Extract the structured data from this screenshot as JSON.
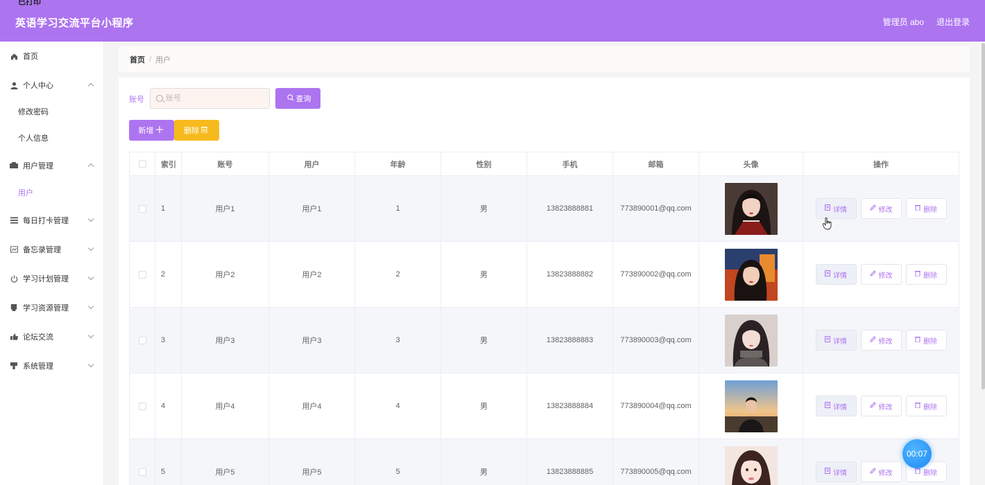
{
  "header": {
    "corner_mark": "已打印",
    "title": "英语学习交流平台小程序",
    "admin_label": "管理员 abo",
    "logout_label": "退出登录"
  },
  "sidebar": {
    "items": [
      {
        "label": "首页",
        "icon": "home-icon"
      },
      {
        "label": "个人中心",
        "icon": "person-icon",
        "expanded": true
      },
      {
        "label": "修改密码",
        "sub": true
      },
      {
        "label": "个人信息",
        "sub": true
      },
      {
        "label": "用户管理",
        "icon": "users-icon",
        "expanded": true
      },
      {
        "label": "用户",
        "sub": true,
        "active": true
      },
      {
        "label": "每日打卡管理",
        "icon": "list-icon"
      },
      {
        "label": "备忘录管理",
        "icon": "memo-icon"
      },
      {
        "label": "学习计划管理",
        "icon": "power-icon"
      },
      {
        "label": "学习资源管理",
        "icon": "resource-icon"
      },
      {
        "label": "论坛交流",
        "icon": "forum-icon"
      },
      {
        "label": "系统管理",
        "icon": "system-icon"
      }
    ]
  },
  "breadcrumb": {
    "home": "首页",
    "separator": "/",
    "current": "用户"
  },
  "search": {
    "label": "账号",
    "placeholder": "账号",
    "value": "",
    "query_label": "查询"
  },
  "toolbar": {
    "add_label": "新增",
    "delete_label": "删除"
  },
  "table": {
    "headers": [
      "索引",
      "账号",
      "用户",
      "年龄",
      "性别",
      "手机",
      "邮箱",
      "头像",
      "操作"
    ],
    "rows": [
      {
        "index": "1",
        "account": "用户1",
        "user": "用户1",
        "age": "1",
        "gender": "男",
        "phone": "13823888881",
        "email": "773890001@qq.com"
      },
      {
        "index": "2",
        "account": "用户2",
        "user": "用户2",
        "age": "2",
        "gender": "男",
        "phone": "13823888882",
        "email": "773890002@qq.com"
      },
      {
        "index": "3",
        "account": "用户3",
        "user": "用户3",
        "age": "3",
        "gender": "男",
        "phone": "13823888883",
        "email": "773890003@qq.com"
      },
      {
        "index": "4",
        "account": "用户4",
        "user": "用户4",
        "age": "4",
        "gender": "男",
        "phone": "13823888884",
        "email": "773890004@qq.com"
      },
      {
        "index": "5",
        "account": "用户5",
        "user": "用户5",
        "age": "5",
        "gender": "男",
        "phone": "13823888885",
        "email": "773890005@qq.com"
      }
    ],
    "ops": {
      "detail": "详情",
      "edit": "修改",
      "delete": "删除"
    }
  },
  "timer": {
    "value": "00:07"
  },
  "colors": {
    "accent": "#ad74f0",
    "warning": "#f7ba1e",
    "timer": "#1e88f5"
  }
}
